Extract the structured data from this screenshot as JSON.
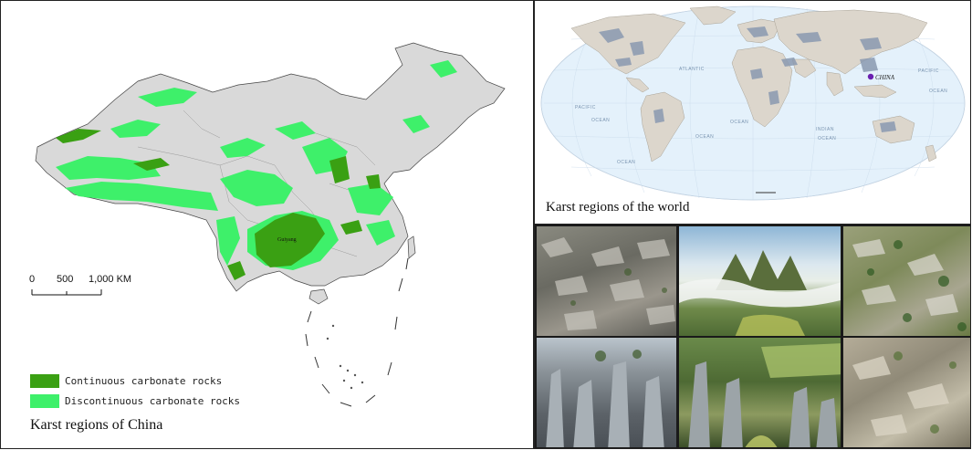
{
  "china_map": {
    "title": "Karst regions of China",
    "city_label": "Guiyang",
    "scale_labels": [
      "0",
      "500",
      "1,000 KM"
    ],
    "legend": [
      {
        "label": "Continuous carbonate rocks",
        "color": "#3aa013"
      },
      {
        "label": "Discontinuous carbonate rocks",
        "color": "#3ef06a"
      }
    ],
    "colors": {
      "land": "#d9d9d9",
      "border": "#444444"
    }
  },
  "world_map": {
    "title": "Karst regions of the world",
    "marker_label": "CHINA",
    "marker_color": "#6a1fb0",
    "ocean_labels": [
      "ATLANTIC",
      "PACIFIC",
      "OCEAN",
      "OCEAN",
      "INDIAN",
      "OCEAN",
      "PACIFIC",
      "OCEAN",
      "OCEAN",
      "OCEAN"
    ],
    "colors": {
      "ocean": "#e4f1fb",
      "land": "#dcd6cc",
      "karst": "#8a99b0"
    }
  },
  "photos": [
    {
      "name": "karst-photo-rock-field"
    },
    {
      "name": "karst-photo-peaks-clouds"
    },
    {
      "name": "karst-photo-aerial-rocks"
    },
    {
      "name": "karst-photo-stone-forest"
    },
    {
      "name": "karst-photo-pinnacles-fields"
    },
    {
      "name": "karst-photo-rocky-slope"
    }
  ]
}
